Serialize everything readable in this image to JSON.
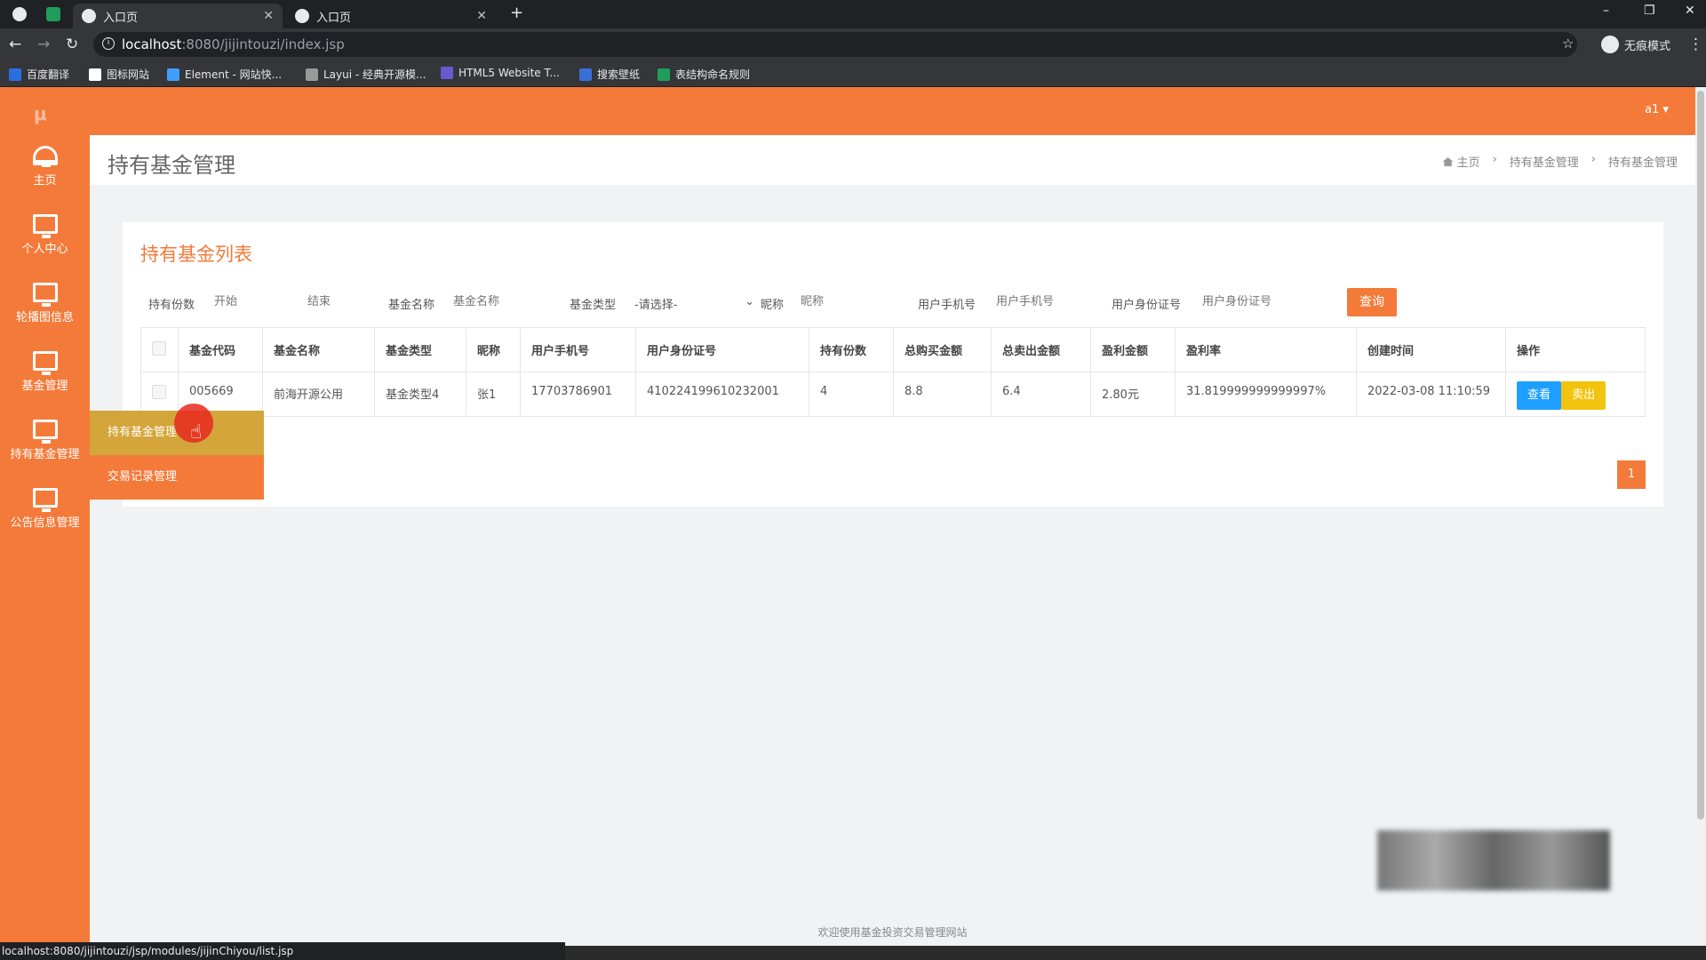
{
  "browser": {
    "tabs": [
      {
        "title": "入口页",
        "active": true
      },
      {
        "title": "入口页",
        "active": false
      }
    ],
    "url_host": "localhost",
    "url_path": ":8080/jijintouzi/index.jsp",
    "incognito_label": "无痕模式",
    "bookmarks": [
      "百度翻译",
      "图标网站",
      "Element - 网站快...",
      "Layui - 经典开源模...",
      "HTML5 Website T...",
      "搜索壁纸",
      "表结构命名规则"
    ],
    "status_url": "localhost:8080/jijintouzi/jsp/modules/jijinChiyou/list.jsp"
  },
  "app": {
    "user": "a1",
    "accent_color": "#f47a3a",
    "sidebar": [
      {
        "label": "主页",
        "icon": "dashboard-icon"
      },
      {
        "label": "个人中心",
        "icon": "monitor-icon"
      },
      {
        "label": "轮播图信息",
        "icon": "monitor-icon"
      },
      {
        "label": "基金管理",
        "icon": "monitor-icon"
      },
      {
        "label": "持有基金管理",
        "icon": "monitor-icon"
      },
      {
        "label": "公告信息管理",
        "icon": "monitor-icon"
      }
    ],
    "flyout": [
      "持有基金管理",
      "交易记录管理"
    ],
    "page_title": "持有基金管理",
    "breadcrumb": [
      "主页",
      "持有基金管理",
      "持有基金管理"
    ],
    "card_title": "持有基金列表",
    "filters": {
      "shares_label": "持有份数",
      "shares_start_placeholder": "开始",
      "shares_end_placeholder": "结束",
      "fund_name_label": "基金名称",
      "fund_name_placeholder": "基金名称",
      "fund_type_label": "基金类型",
      "fund_type_value": "-请选择-",
      "nickname_label": "昵称",
      "nickname_placeholder": "昵称",
      "phone_label": "用户手机号",
      "phone_placeholder": "用户手机号",
      "idcard_label": "用户身份证号",
      "idcard_placeholder": "用户身份证号",
      "query_button": "查询"
    },
    "table": {
      "headers": [
        "基金代码",
        "基金名称",
        "基金类型",
        "昵称",
        "用户手机号",
        "用户身份证号",
        "持有份数",
        "总购买金额",
        "总卖出金额",
        "盈利金额",
        "盈利率",
        "创建时间",
        "操作"
      ],
      "rows": [
        [
          "005669",
          "前海开源公用",
          "基金类型4",
          "张1",
          "17703786901",
          "410224199610232001",
          "4",
          "8.8",
          "6.4",
          "2.80元",
          "31.819999999999997%",
          "2022-03-08 11:10:59"
        ]
      ],
      "view_button": "查看",
      "sell_button": "卖出"
    },
    "page_number": "1",
    "footer": "欢迎使用基金投资交易管理网站"
  }
}
